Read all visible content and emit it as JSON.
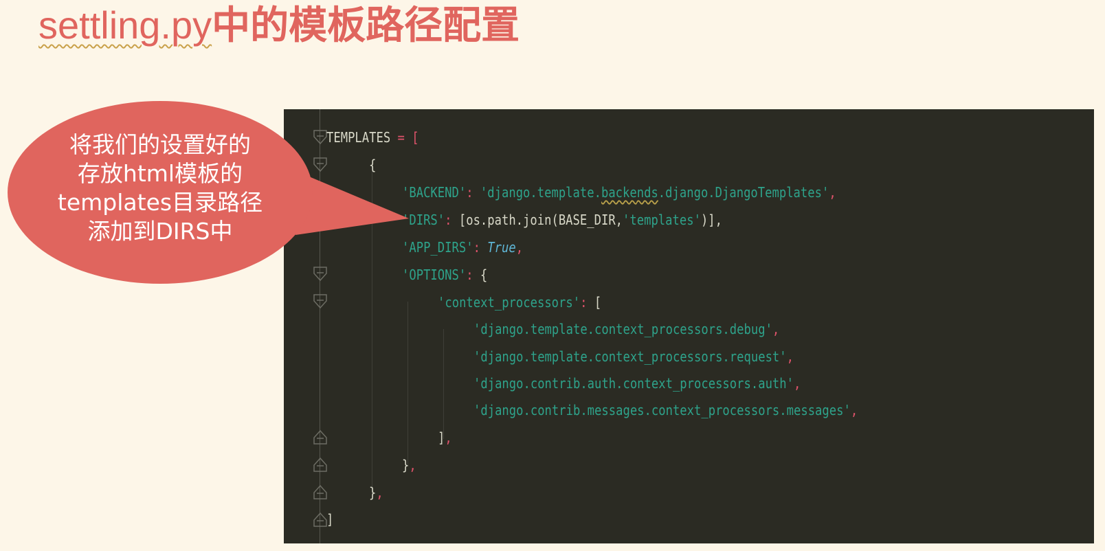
{
  "title": {
    "filename": "settling.py",
    "rest": "中的模板路径配置"
  },
  "callout": {
    "lines": [
      "将我们的设置好的",
      "存放html模板的",
      "templates目录路径",
      "添加到DIRS中"
    ],
    "color": "#e0655e"
  },
  "code": {
    "l1_name": "TEMPLATES",
    "l1_op": " = ",
    "l1_bracket": "[",
    "l2": "{",
    "l3_key": "'BACKEND'",
    "l3_colon": ": ",
    "l3_val_a": "'django.template.",
    "l3_val_b": "backends",
    "l3_val_c": ".django.DjangoTemplates'",
    "l3_comma": ",",
    "l4_key": "'DIRS'",
    "l4_colon": ": ",
    "l4_a": "[os.path.join(BASE_DIR,",
    "l4_str": "'templates'",
    "l4_b": ")],",
    "l5_key": "'APP_DIRS'",
    "l5_colon": ": ",
    "l5_val": "True",
    "l5_comma": ",",
    "l6_key": "'OPTIONS'",
    "l6_colon": ": ",
    "l6_brace": "{",
    "l7_key": "'context_processors'",
    "l7_colon": ": ",
    "l7_bracket": "[",
    "l8": "'django.template.context_processors.debug'",
    "l9": "'django.template.context_processors.request'",
    "l10": "'django.contrib.auth.context_processors.auth'",
    "l11": "'django.contrib.messages.context_processors.messages'",
    "comma": ",",
    "l12": "]",
    "l13": "}",
    "l14": "}",
    "l15": "]"
  },
  "colors": {
    "background": "#fdf6e8",
    "editor_bg": "#2b2b23",
    "string": "#2ea38b",
    "operator": "#e0536b",
    "keyword": "#5fb6d6",
    "text": "#d8d8c8"
  }
}
